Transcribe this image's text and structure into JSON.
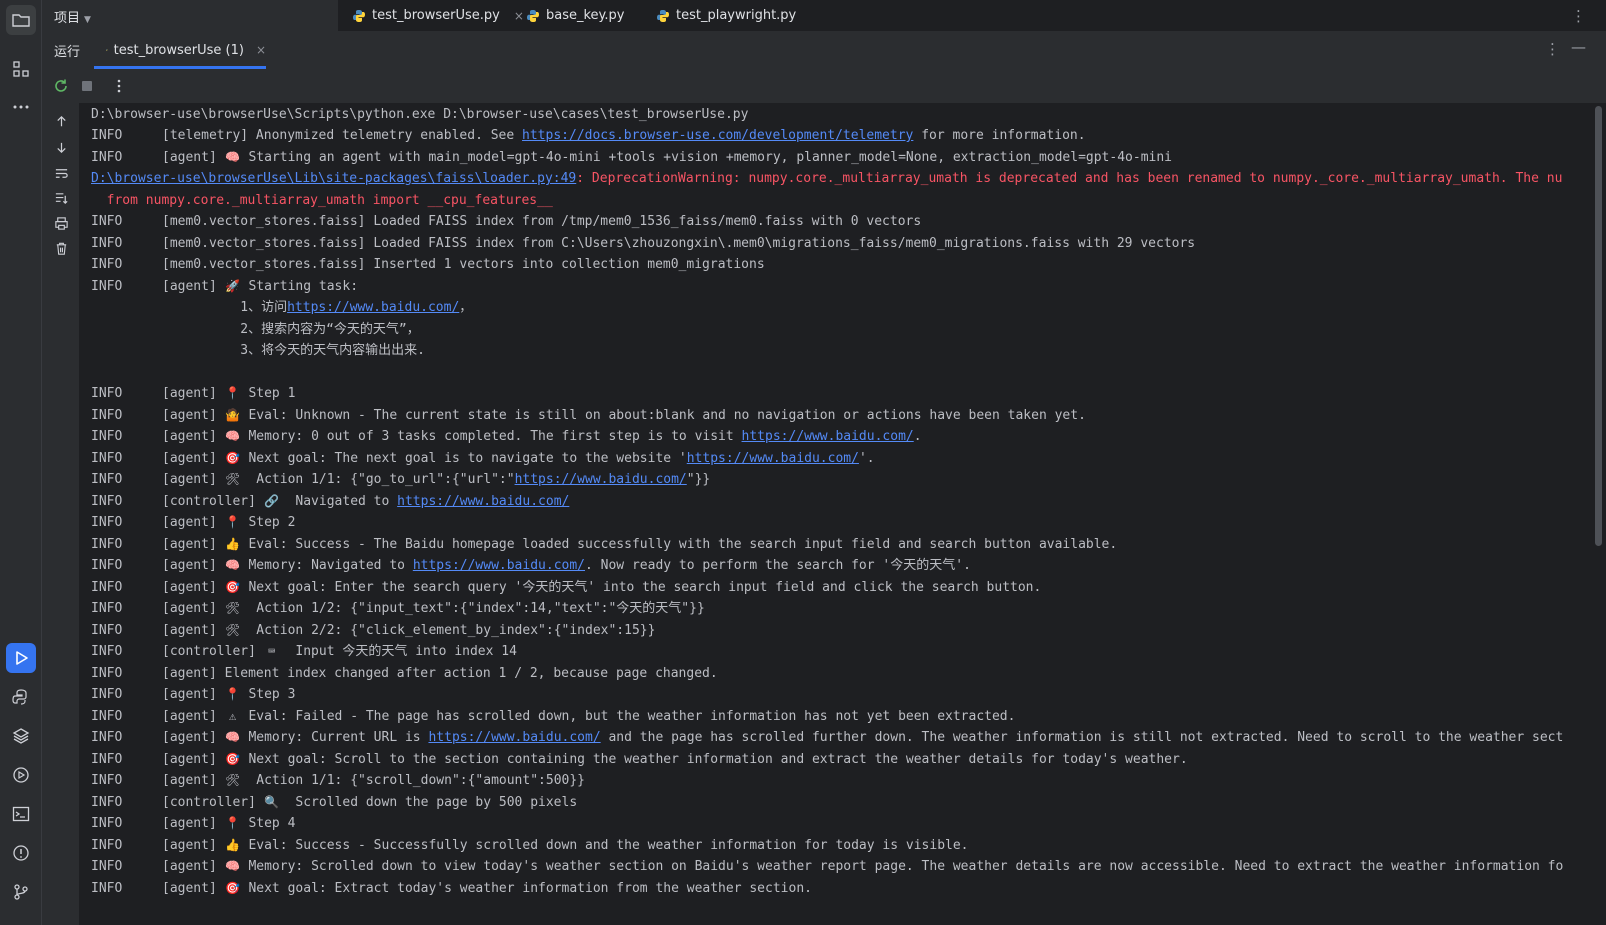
{
  "activity_bar": {
    "icons": [
      "folder-icon",
      "structure-icon",
      "more-icon",
      "run-icon",
      "python-console-icon",
      "layers-icon",
      "services-icon",
      "terminal-icon",
      "problems-icon",
      "git-icon"
    ]
  },
  "top_bar": {
    "project_label": "项目",
    "tabs": [
      {
        "label": "test_browserUse.py",
        "active": true
      },
      {
        "label": "base_key.py",
        "active": false
      },
      {
        "label": "test_playwright.py",
        "active": false
      }
    ],
    "close_glyph": "×",
    "more_glyph": "⋮"
  },
  "run_window": {
    "title": "运行",
    "tab_label": "test_browserUse (1)",
    "more_glyph": "⋮",
    "minimize_glyph": "—"
  },
  "console": {
    "level": "INFO",
    "lines": {
      "l0": "D:\\browser-use\\browserUse\\Scripts\\python.exe D:\\browser-use\\cases\\test_browserUse.py",
      "l1a": "[telemetry] Anonymized telemetry enabled. See ",
      "l1_link": "https://docs.browser-use.com/development/telemetry",
      "l1b": " for more information.",
      "l2": "[agent] ",
      "l2b": " Starting an agent with main_model=gpt-4o-mini +tools +vision +memory, planner_model=None, extraction_model=gpt-4o-mini",
      "l3_link": "D:\\browser-use\\browserUse\\Lib\\site-packages\\faiss\\loader.py:49",
      "l3b": ": DeprecationWarning: numpy.core._multiarray_umath is deprecated and has been renamed to numpy._core._multiarray_umath. The nu",
      "l4": "  from numpy.core._multiarray_umath import __cpu_features__",
      "l5": "[mem0.vector_stores.faiss] Loaded FAISS index from /tmp/mem0_1536_faiss/mem0.faiss with 0 vectors",
      "l6": "[mem0.vector_stores.faiss] Loaded FAISS index from C:\\Users\\zhouzongxin\\.mem0\\migrations_faiss/mem0_migrations.faiss with 29 vectors",
      "l7": "[mem0.vector_stores.faiss] Inserted 1 vectors into collection mem0_migrations",
      "l8": "[agent] ",
      "l8b": " Starting task:",
      "l9a": "          1、访问",
      "l9_link": "https://www.baidu.com/",
      "l9b": "，",
      "l10": "          2、搜索内容为“今天的天气”，",
      "l11": "          3、将今天的天气内容输出出来.",
      "l13": "[agent] ",
      "l13b": " Step 1",
      "l14": "[agent] ",
      "l14b": " Eval: Unknown - The current state is still on about:blank and no navigation or actions have been taken yet.",
      "l15": "[agent] ",
      "l15b": " Memory: 0 out of 3 tasks completed. The first step is to visit ",
      "l15_link": "https://www.baidu.com/",
      "l15c": ".",
      "l16": "[agent] ",
      "l16b": " Next goal: The next goal is to navigate to the website '",
      "l16_link": "https://www.baidu.com/",
      "l16c": "'.",
      "l17": "[agent] ",
      "l17b": "  Action 1/1: {\"go_to_url\":{\"url\":\"",
      "l17_link": "https://www.baidu.com/",
      "l17c": "\"}}",
      "l18": "[controller] ",
      "l18b": "  Navigated to ",
      "l18_link": "https://www.baidu.com/",
      "l19": "[agent] ",
      "l19b": " Step 2",
      "l20": "[agent] ",
      "l20b": " Eval: Success - The Baidu homepage loaded successfully with the search input field and search button available.",
      "l21": "[agent] ",
      "l21b": " Memory: Navigated to ",
      "l21_link": "https://www.baidu.com/",
      "l21c": ". Now ready to perform the search for '今天的天气'.",
      "l22": "[agent] ",
      "l22b": " Next goal: Enter the search query '今天的天气' into the search input field and click the search button.",
      "l23": "[agent] ",
      "l23b": "  Action 1/2: {\"input_text\":{\"index\":14,\"text\":\"今天的天气\"}}",
      "l24": "[agent] ",
      "l24b": "  Action 2/2: {\"click_element_by_index\":{\"index\":15}}",
      "l25": "[controller] ",
      "l25b": "  Input 今天的天气 into index 14",
      "l26": "[agent] Element index changed after action 1 / 2, because page changed.",
      "l27": "[agent] ",
      "l27b": " Step 3",
      "l28": "[agent] ",
      "l28b": " Eval: Failed - The page has scrolled down, but the weather information has not yet been extracted.",
      "l29": "[agent] ",
      "l29b": " Memory: Current URL is ",
      "l29_link": "https://www.baidu.com/",
      "l29c": " and the page has scrolled further down. The weather information is still not extracted. Need to scroll to the weather sect",
      "l30": "[agent] ",
      "l30b": " Next goal: Scroll to the section containing the weather information and extract the weather details for today's weather.",
      "l31": "[agent] ",
      "l31b": "  Action 1/1: {\"scroll_down\":{\"amount\":500}}",
      "l32": "[controller] ",
      "l32b": "  Scrolled down the page by 500 pixels",
      "l33": "[agent] ",
      "l33b": " Step 4",
      "l34": "[agent] ",
      "l34b": " Eval: Success - Successfully scrolled down and the weather information for today is visible.",
      "l35": "[agent] ",
      "l35b": " Memory: Scrolled down to view today's weather section on Baidu's weather report page. The weather details are now accessible. Need to extract the weather information fo",
      "l36": "[agent] ",
      "l36b": " Next goal: Extract today's weather information from the weather section."
    },
    "emojis": {
      "brain": "🧠",
      "rocket": "🚀",
      "pin": "📍",
      "judge": "🤷",
      "target": "🎯",
      "tools": "🛠",
      "link": "🔗",
      "thumb": "👍",
      "keyboard": "⌨",
      "warn": "⚠",
      "search": "🔍"
    }
  },
  "colors": {
    "accent": "#3574f0",
    "link": "#548af7",
    "error": "#f75464",
    "text": "#bcbec4",
    "background": "#1e1f22",
    "panel": "#2b2d30"
  }
}
